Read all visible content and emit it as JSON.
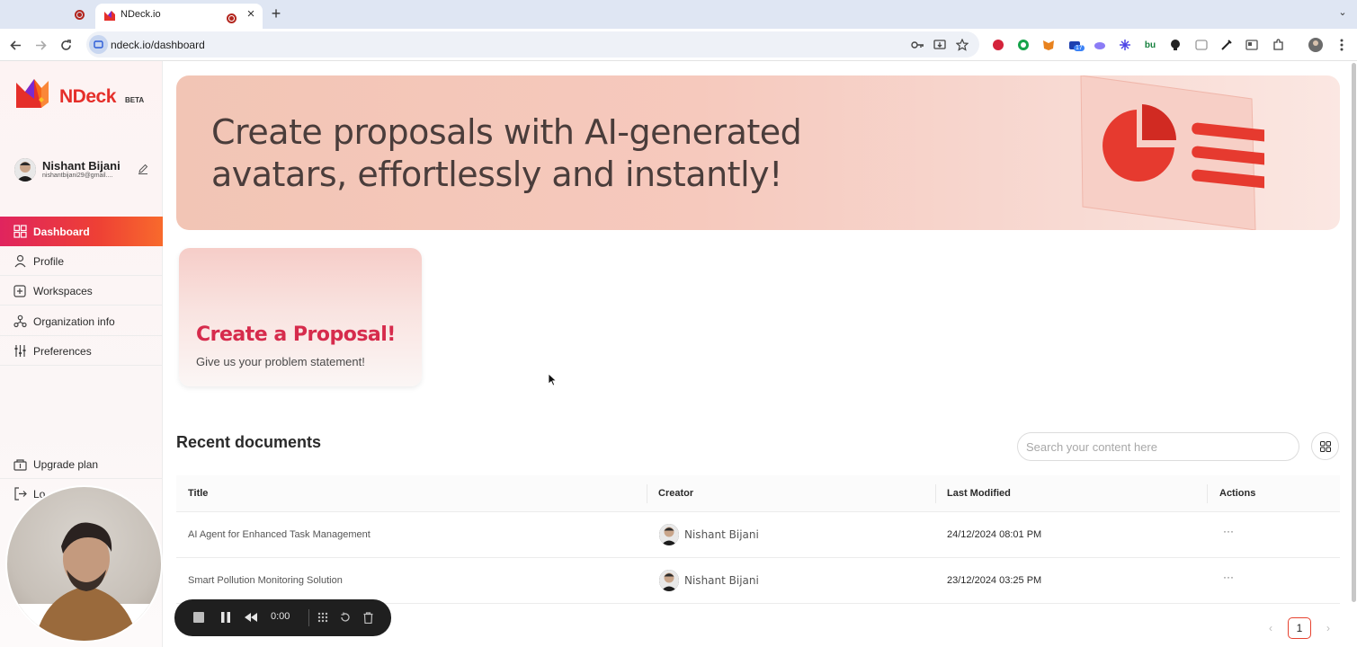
{
  "browser": {
    "active_tab_title": "NDeck.io",
    "url": "ndeck.io/dashboard",
    "new_tab_glyph": "+",
    "close_glyph": "×",
    "extension_badge": "17"
  },
  "sidebar": {
    "brand": "NDeck",
    "beta": "BETA",
    "user": {
      "name": "Nishant Bijani",
      "email": "nishantbijani29@gmail...."
    },
    "items": [
      {
        "label": "Dashboard",
        "icon": "dashboard-grid-icon",
        "active": true
      },
      {
        "label": "Profile",
        "icon": "person-icon"
      },
      {
        "label": "Workspaces",
        "icon": "workspace-add-icon"
      },
      {
        "label": "Organization info",
        "icon": "organization-icon"
      },
      {
        "label": "Preferences",
        "icon": "sliders-icon"
      }
    ],
    "bottom_items": [
      {
        "label": "Upgrade plan",
        "icon": "upgrade-icon"
      },
      {
        "label": "Lo",
        "icon": "logout-icon"
      }
    ]
  },
  "banner": {
    "headline": "Create proposals with AI-generated avatars, effortlessly and instantly!"
  },
  "proposal_card": {
    "title": "Create a Proposal!",
    "subtitle": "Give us your problem statement!"
  },
  "recent": {
    "title": "Recent documents",
    "search_placeholder": "Search your content here",
    "columns": [
      "Title",
      "Creator",
      "Last Modified",
      "Actions"
    ],
    "rows": [
      {
        "title": "AI Agent for Enhanced Task Management",
        "creator": "Nishant Bijani",
        "modified": "24/12/2024 08:01 PM",
        "actions": "···"
      },
      {
        "title": "Smart Pollution Monitoring Solution",
        "creator": "Nishant Bijani",
        "modified": "23/12/2024 03:25 PM",
        "actions": "···"
      }
    ],
    "pagination": {
      "prev": "‹",
      "current": "1",
      "next": "›"
    }
  },
  "recorder": {
    "time": "0:00"
  },
  "colors": {
    "brand_red": "#e52f2a",
    "accent_gradient_start": "#e0245e",
    "accent_gradient_end": "#f86a2c",
    "proposal_title": "#d62b4c"
  }
}
